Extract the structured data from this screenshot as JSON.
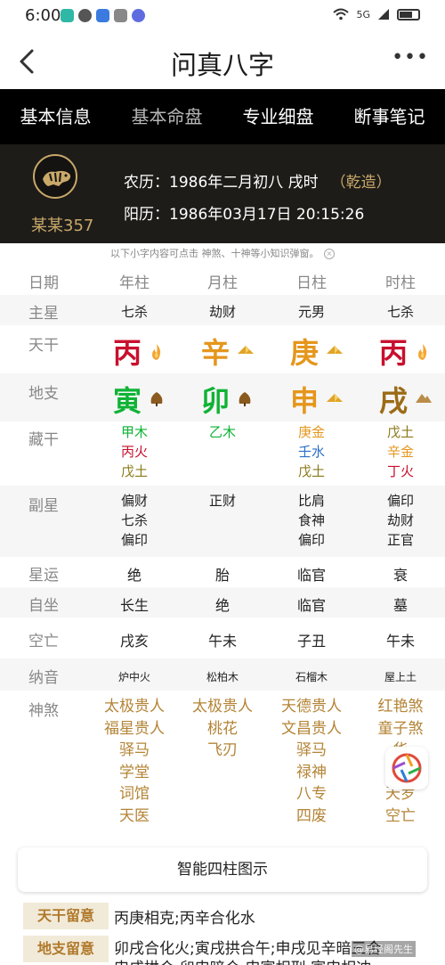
{
  "status": {
    "time": "6:00",
    "network": "5G"
  },
  "nav": {
    "title": "问真八字",
    "back": "<",
    "more": "•••"
  },
  "tabs": [
    "基本信息",
    "基本命盘",
    "专业细盘",
    "断事笔记"
  ],
  "profile": {
    "name": "某某357",
    "lunar_label": "农历：",
    "lunar_value": "1986年二月初八 戌时",
    "gender": "（乾造）",
    "solar_label": "阳历：",
    "solar_value": "1986年03月17日 20:15:26"
  },
  "notice": "以下小字内容可点击 神煞、十神等小知识弹窗。",
  "notice_close": "×",
  "table": {
    "header": {
      "label": "日期",
      "cols": [
        "年柱",
        "月柱",
        "日柱",
        "时柱"
      ]
    },
    "main_star": {
      "label": "主星",
      "cols": [
        "七杀",
        "劫财",
        "元男",
        "七杀"
      ]
    },
    "tiangan": {
      "label": "天干",
      "chars": [
        "丙",
        "辛",
        "庚",
        "丙"
      ],
      "icons": [
        "fire-icon",
        "metal-icon",
        "metal-icon",
        "fire-icon"
      ]
    },
    "dizhi": {
      "label": "地支",
      "chars": [
        "寅",
        "卯",
        "申",
        "戌"
      ],
      "icons": [
        "wood-icon",
        "wood-icon",
        "metal-icon",
        "earth-icon"
      ]
    },
    "canggan": {
      "label": "藏干",
      "cols": [
        [
          "甲木",
          "丙火",
          "戊土"
        ],
        [
          "乙木"
        ],
        [
          "庚金",
          "壬水",
          "戊土"
        ],
        [
          "戊土",
          "辛金",
          "丁火"
        ]
      ]
    },
    "fuxing": {
      "label": "副星",
      "cols": [
        [
          "偏财",
          "七杀",
          "偏印"
        ],
        [
          "正财"
        ],
        [
          "比肩",
          "食神",
          "偏印"
        ],
        [
          "偏印",
          "劫财",
          "正官"
        ]
      ]
    },
    "xingyun": {
      "label": "星运",
      "cols": [
        "绝",
        "胎",
        "临官",
        "衰"
      ]
    },
    "zizuo": {
      "label": "自坐",
      "cols": [
        "长生",
        "绝",
        "临官",
        "墓"
      ]
    },
    "kongwang": {
      "label": "空亡",
      "cols": [
        "戌亥",
        "午未",
        "子丑",
        "午未"
      ]
    },
    "nayin": {
      "label": "纳音",
      "cols": [
        "炉中火",
        "松柏木",
        "石榴木",
        "屋上土"
      ]
    },
    "shensha": {
      "label": "神煞",
      "cols": [
        [
          "太极贵人",
          "福星贵人",
          "驿马",
          "学堂",
          "词馆",
          "天医"
        ],
        [
          "太极贵人",
          "桃花",
          "飞刃"
        ],
        [
          "天德贵人",
          "文昌贵人",
          "驿马",
          "禄神",
          "八专",
          "四废"
        ],
        [
          "红艳煞",
          "童子煞",
          "华",
          "金",
          "天罗",
          "空亡"
        ]
      ]
    }
  },
  "smart_button": "智能四柱图示",
  "notes": [
    {
      "badge": "天干留意",
      "text": "丙庚相克;丙辛合化水"
    },
    {
      "badge": "地支留意",
      "text": "卯戌合化火;寅戌拱合午;申戌见辛暗三合"
    },
    {
      "badge": "",
      "text": "申戌拱合;卯申暗合;申寅相刑;寅申相冲"
    }
  ],
  "watermark": "@易经阁先生",
  "colors": {
    "fire": "#c8102e",
    "metal": "#e5961c",
    "wood": "#0fb335",
    "earth": "#9b6b16",
    "water": "#2a6fc9",
    "accent_gold": "#c9a869"
  }
}
